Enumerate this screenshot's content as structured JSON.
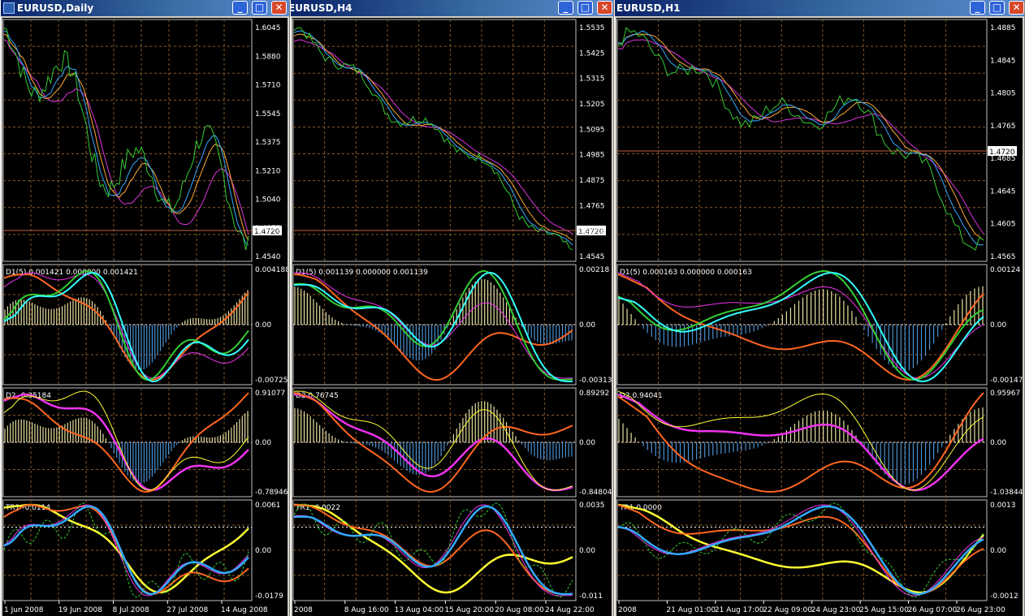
{
  "windows": [
    {
      "id": "daily",
      "title": "EURUSD,Daily",
      "price_label": "1.4720",
      "price_ticks": [
        "1.6045",
        "1.5880",
        "1.5710",
        "1.5545",
        "1.5375",
        "1.5210",
        "1.5040",
        "1.4875",
        "1.4540"
      ],
      "ind1_label": "D1(5) 0.001421 0.000000 0.001421",
      "ind1_ticks": [
        "0.004188",
        "0.00",
        "-0.00725"
      ],
      "ind2_label": "D2 -0.35184",
      "ind2_ticks": [
        "0.91077",
        "0.00",
        "-0.78946"
      ],
      "ind3_label": "TR1 -0.0114",
      "ind3_ticks": [
        "0.0061",
        "0.00",
        "-0.0179"
      ],
      "x_labels": [
        "1 Jun 2008",
        "19 Jun 2008",
        "8 Jul 2008",
        "27 Jul 2008",
        "14 Aug 2008"
      ]
    },
    {
      "id": "h4",
      "title": "EURUSD,H4",
      "price_label": "1.4720",
      "price_ticks": [
        "1.5535",
        "1.5425",
        "1.5315",
        "1.5205",
        "1.5095",
        "1.4985",
        "1.4875",
        "1.4765",
        "1.4655",
        "1.4545"
      ],
      "ind1_label": "D1(5) 0.001139 0.000000 0.001139",
      "ind1_ticks": [
        "0.00218",
        "0.00",
        "-0.00313"
      ],
      "ind2_label": "D2 0.76745",
      "ind2_ticks": [
        "0.89292",
        "0.00",
        "-0.84804"
      ],
      "ind3_label": "TR1 -0.0022",
      "ind3_ticks": [
        "0.0035",
        "0.00",
        "-0.011"
      ],
      "x_labels": [
        "2008",
        "8 Aug 16:00",
        "13 Aug 04:00",
        "15 Aug 20:00",
        "20 Aug 08:00",
        "24 Aug 22:00"
      ]
    },
    {
      "id": "h1",
      "title": "EURUSD,H1",
      "price_label": "1.4720",
      "price_ticks": [
        "1.4885",
        "1.4845",
        "1.4805",
        "1.4765",
        "1.4685",
        "1.4645",
        "1.4605",
        "1.4565"
      ],
      "ind1_label": "D1(5) 0.000163 0.000000 0.000163",
      "ind1_ticks": [
        "0.00124",
        "0.00",
        "-0.00147"
      ],
      "ind2_label": "D2 0.94041",
      "ind2_ticks": [
        "0.95967",
        "0.00",
        "-1.03844"
      ],
      "ind3_label": "TR1 0.0000",
      "ind3_ticks": [
        "0.0013",
        "0.00",
        "-0.0012"
      ],
      "x_labels": [
        "2008",
        "21 Aug 01:00",
        "21 Aug 17:00",
        "22 Aug 09:00",
        "24 Aug 23:00",
        "25 Aug 15:00",
        "26 Aug 07:00",
        "26 Aug 23:00"
      ]
    }
  ],
  "colors": {
    "price_line": "#33cc33",
    "ma_fast": "#33aaff",
    "ma_mid": "#ffaa33",
    "ma_slow": "#dd33dd",
    "grid": "#8a5a2a",
    "hist_pos": "#e8e0a0",
    "hist_neg": "#4a90d0",
    "cyan": "#33ffff",
    "orange": "#ff6620",
    "magenta": "#ee33ee",
    "yellow": "#ffff33"
  }
}
